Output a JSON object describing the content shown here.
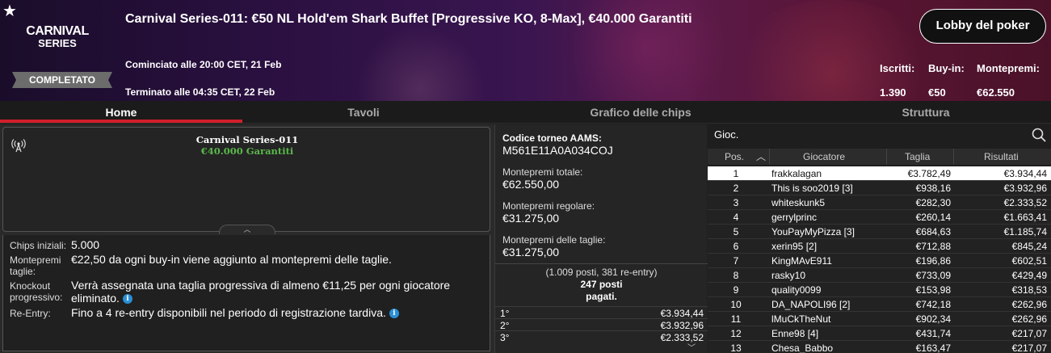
{
  "header": {
    "logo_line1": "CARNIVAL",
    "logo_line2": "SERIES",
    "status_badge": "COMPLETATO",
    "title": "Carnival Series-011: €50 NL Hold'em Shark Buffet [Progressive KO, 8-Max], €40.000 Garantiti",
    "started": "Cominciato alle 20:00 CET, 21 Feb",
    "ended": "Terminato alle 04:35 CET, 22 Feb",
    "lobby_button": "Lobby del poker",
    "stats": {
      "entrants_label": "Iscritti:",
      "entrants_value": "1.390",
      "buyin_label": "Buy-in:",
      "buyin_value": "€50",
      "prizepool_label": "Montepremi:",
      "prizepool_value": "€62.550"
    }
  },
  "tabs": [
    "Home",
    "Tavoli",
    "Grafico delle chips",
    "Struttura"
  ],
  "info": {
    "title": "Carnival Series-011",
    "subtitle": "€40.000 Garantiti"
  },
  "details": {
    "chips_label": "Chips iniziali:",
    "chips_value": "5.000",
    "bounty_pool_label1": "Montepremi",
    "bounty_pool_label2": "taglie:",
    "bounty_pool_value": "€22,50 da ogni buy-in viene aggiunto al montepremi delle taglie.",
    "ko_label1": "Knockout",
    "ko_label2": "progressivo:",
    "ko_value1": "Verrà assegnata una taglia progressiva di almeno €11,25 per ogni giocatore",
    "ko_value2": "eliminato.",
    "reentry_label": "Re-Entry:",
    "reentry_value": "Fino a 4 re-entry disponibili nel periodo di registrazione tardiva."
  },
  "summary": {
    "aams_label": "Codice torneo AAMS:",
    "aams_value": "M561E11A0A034COJ",
    "total_label": "Montepremi totale:",
    "total_value": "€62.550,00",
    "regular_label": "Montepremi regolare:",
    "regular_value": "€31.275,00",
    "bounty_label": "Montepremi delle taglie:",
    "bounty_value": "€31.275,00",
    "seats_line1": "(1.009 posti, 381 re-entry)",
    "seats_line2": "247 posti",
    "seats_line3": "pagati."
  },
  "payouts": [
    {
      "place": "1°",
      "amount": "€3.934,44"
    },
    {
      "place": "2°",
      "amount": "€3.932,96"
    },
    {
      "place": "3°",
      "amount": "€2.333,52"
    }
  ],
  "players": {
    "search_label": "Gioc.",
    "headers": {
      "pos": "Pos.",
      "player": "Giocatore",
      "bounty": "Taglia",
      "results": "Risultati"
    },
    "rows": [
      {
        "pos": "1",
        "name": "frakkalagan",
        "bounty": "€3.782,49",
        "result": "€3.934,44"
      },
      {
        "pos": "2",
        "name": "This is soo2019 [3]",
        "bounty": "€938,16",
        "result": "€3.932,96"
      },
      {
        "pos": "3",
        "name": "whiteskunk5",
        "bounty": "€282,30",
        "result": "€2.333,52"
      },
      {
        "pos": "4",
        "name": "gerrylprinc",
        "bounty": "€260,14",
        "result": "€1.663,41"
      },
      {
        "pos": "5",
        "name": "YouPayMyPizza [3]",
        "bounty": "€684,63",
        "result": "€1.185,74"
      },
      {
        "pos": "6",
        "name": "xerin95 [2]",
        "bounty": "€712,88",
        "result": "€845,24"
      },
      {
        "pos": "7",
        "name": "KingMAvE911",
        "bounty": "€196,86",
        "result": "€602,51"
      },
      {
        "pos": "8",
        "name": "rasky10",
        "bounty": "€733,09",
        "result": "€429,49"
      },
      {
        "pos": "9",
        "name": "quality0099",
        "bounty": "€153,98",
        "result": "€318,53"
      },
      {
        "pos": "10",
        "name": "DA_NAPOLI96 [2]",
        "bounty": "€742,18",
        "result": "€262,96"
      },
      {
        "pos": "11",
        "name": "lMuCkTheNut",
        "bounty": "€902,34",
        "result": "€262,96"
      },
      {
        "pos": "12",
        "name": "Enne98 [4]",
        "bounty": "€431,74",
        "result": "€217,07"
      },
      {
        "pos": "13",
        "name": "Chesa_Babbo",
        "bounty": "€163,47",
        "result": "€217,07"
      }
    ]
  },
  "colors": {
    "accent_red": "#d0202a",
    "bounty_green": "#5ab84a",
    "info_blue": "#2a8fd6"
  }
}
